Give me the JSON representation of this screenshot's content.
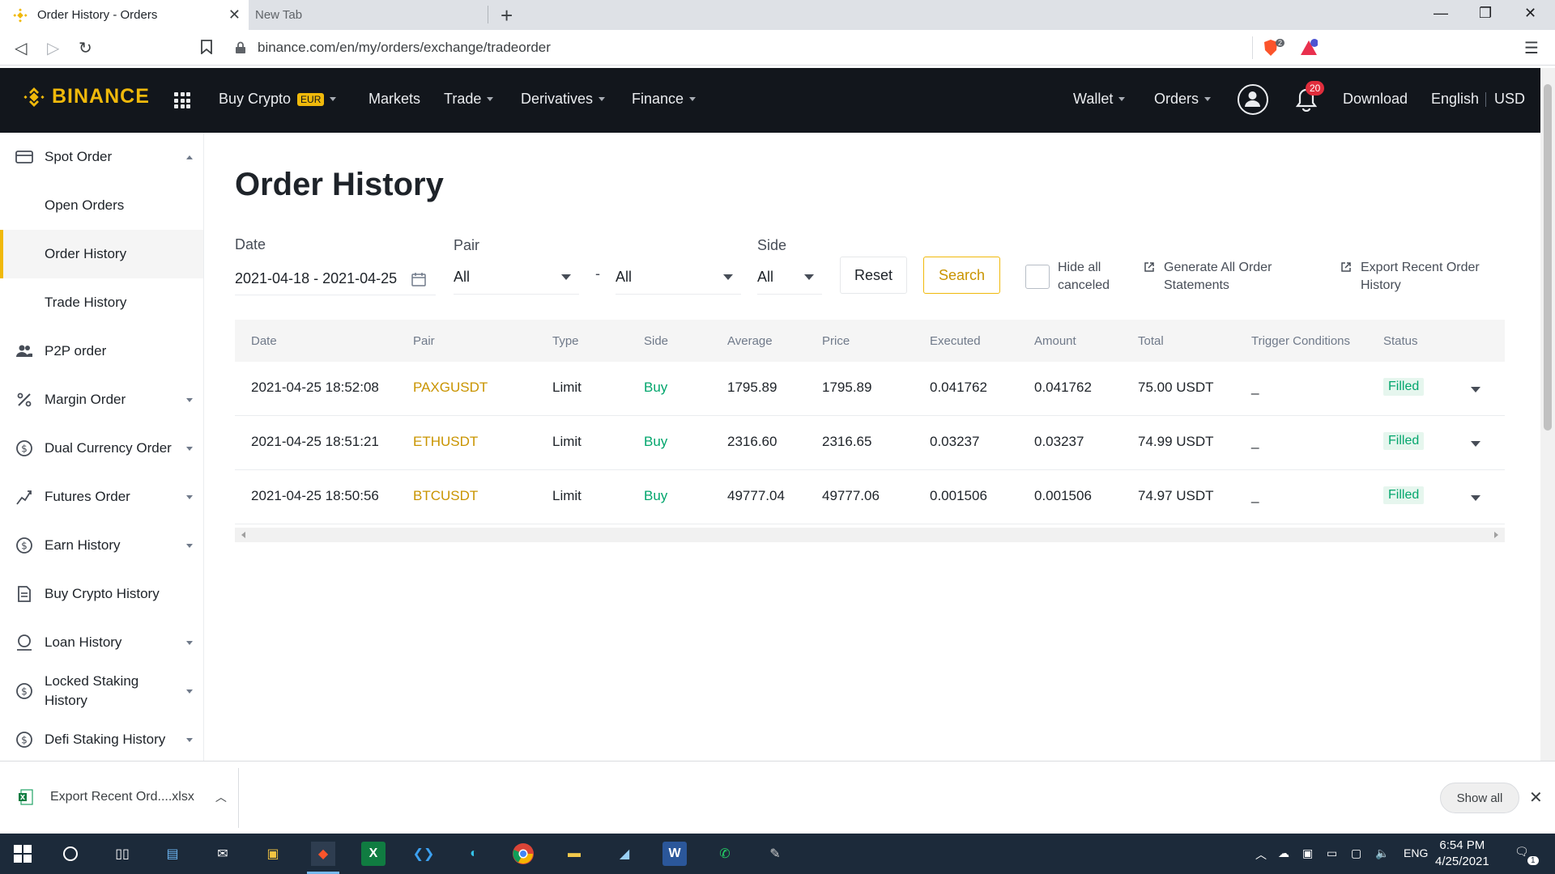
{
  "browser": {
    "active_tab": "Order History - Orders",
    "inactive_tab": "New Tab",
    "url": "binance.com/en/my/orders/exchange/tradeorder",
    "brave_badge": "2"
  },
  "header": {
    "logo": "BINANCE",
    "nav": {
      "buy_crypto": "Buy Crypto",
      "eur": "EUR",
      "markets": "Markets",
      "trade": "Trade",
      "derivatives": "Derivatives",
      "finance": "Finance",
      "wallet": "Wallet",
      "orders": "Orders",
      "download": "Download",
      "language": "English",
      "currency": "USD"
    },
    "notifications": "20"
  },
  "sidebar": {
    "items": [
      {
        "label": "Spot Order"
      },
      {
        "label": "Open Orders"
      },
      {
        "label": "Order History"
      },
      {
        "label": "Trade History"
      },
      {
        "label": "P2P order"
      },
      {
        "label": "Margin Order"
      },
      {
        "label": "Dual Currency Order"
      },
      {
        "label": "Futures Order"
      },
      {
        "label": "Earn History"
      },
      {
        "label": "Buy Crypto History"
      },
      {
        "label": "Loan History"
      },
      {
        "label": "Locked Staking History"
      },
      {
        "label": "Defi Staking History"
      }
    ]
  },
  "main": {
    "title": "Order History",
    "filters": {
      "date_label": "Date",
      "date_value": "2021-04-18 - 2021-04-25",
      "pair_label": "Pair",
      "pair_base": "All",
      "pair_sep": "-",
      "pair_quote": "All",
      "side_label": "Side",
      "side_value": "All",
      "reset": "Reset",
      "search": "Search",
      "hide_canceled_1": "Hide all",
      "hide_canceled_2": "canceled",
      "generate_1": "Generate All Order",
      "generate_2": "Statements",
      "export_1": "Export Recent Order",
      "export_2": "History"
    },
    "table": {
      "columns": [
        "Date",
        "Pair",
        "Type",
        "Side",
        "Average",
        "Price",
        "Executed",
        "Amount",
        "Total",
        "Trigger Conditions",
        "Status"
      ],
      "rows": [
        {
          "date": "2021-04-25 18:52:08",
          "pair": "PAXGUSDT",
          "type": "Limit",
          "side": "Buy",
          "average": "1795.89",
          "price": "1795.89",
          "executed": "0.041762",
          "amount": "0.041762",
          "total": "75.00 USDT",
          "trigger": "_",
          "status": "Filled"
        },
        {
          "date": "2021-04-25 18:51:21",
          "pair": "ETHUSDT",
          "type": "Limit",
          "side": "Buy",
          "average": "2316.60",
          "price": "2316.65",
          "executed": "0.03237",
          "amount": "0.03237",
          "total": "74.99 USDT",
          "trigger": "_",
          "status": "Filled"
        },
        {
          "date": "2021-04-25 18:50:56",
          "pair": "BTCUSDT",
          "type": "Limit",
          "side": "Buy",
          "average": "49777.04",
          "price": "49777.06",
          "executed": "0.001506",
          "amount": "0.001506",
          "total": "74.97 USDT",
          "trigger": "_",
          "status": "Filled"
        }
      ]
    }
  },
  "downloads": {
    "file": "Export Recent Ord....xlsx",
    "show_all": "Show all"
  },
  "taskbar": {
    "lang": "ENG",
    "time": "6:54 PM",
    "date": "4/25/2021",
    "notif_count": "1"
  },
  "colors": {
    "brand": "#f0b90b",
    "header_bg": "#12161c",
    "buy": "#03a66d",
    "pair": "#c99400"
  }
}
